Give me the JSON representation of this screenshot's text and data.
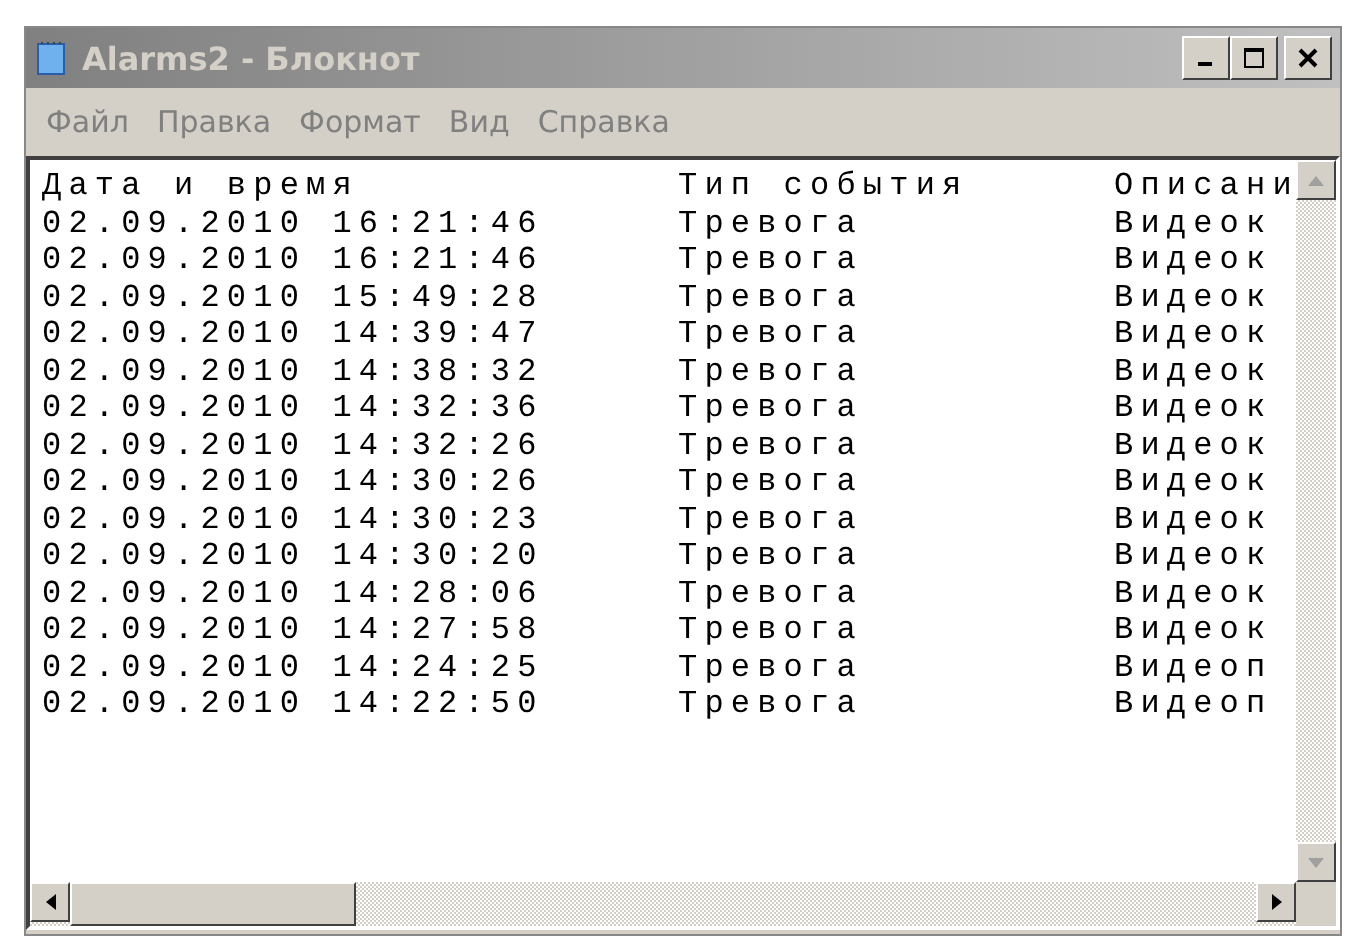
{
  "window": {
    "title": "Alarms2 - Блокнот"
  },
  "menu": [
    "Файл",
    "Правка",
    "Формат",
    "Вид",
    "Справка"
  ],
  "columns": [
    "Дата и время",
    "Тип события",
    "Описани"
  ],
  "rows": [
    [
      "02.09.2010 16:21:46",
      "Тревога",
      "Видеок"
    ],
    [
      "02.09.2010 16:21:46",
      "Тревога",
      "Видеок"
    ],
    [
      "02.09.2010 15:49:28",
      "Тревога",
      "Видеок"
    ],
    [
      "02.09.2010 14:39:47",
      "Тревога",
      "Видеок"
    ],
    [
      "02.09.2010 14:38:32",
      "Тревога",
      "Видеок"
    ],
    [
      "02.09.2010 14:32:36",
      "Тревога",
      "Видеок"
    ],
    [
      "02.09.2010 14:32:26",
      "Тревога",
      "Видеок"
    ],
    [
      "02.09.2010 14:30:26",
      "Тревога",
      "Видеок"
    ],
    [
      "02.09.2010 14:30:23",
      "Тревога",
      "Видеок"
    ],
    [
      "02.09.2010 14:30:20",
      "Тревога",
      "Видеок"
    ],
    [
      "02.09.2010 14:28:06",
      "Тревога",
      "Видеок"
    ],
    [
      "02.09.2010 14:27:58",
      "Тревога",
      "Видеок"
    ],
    [
      "02.09.2010 14:24:25",
      "Тревога",
      "Видеоп"
    ],
    [
      "02.09.2010 14:22:50",
      "Тревога",
      "Видеоп"
    ]
  ]
}
